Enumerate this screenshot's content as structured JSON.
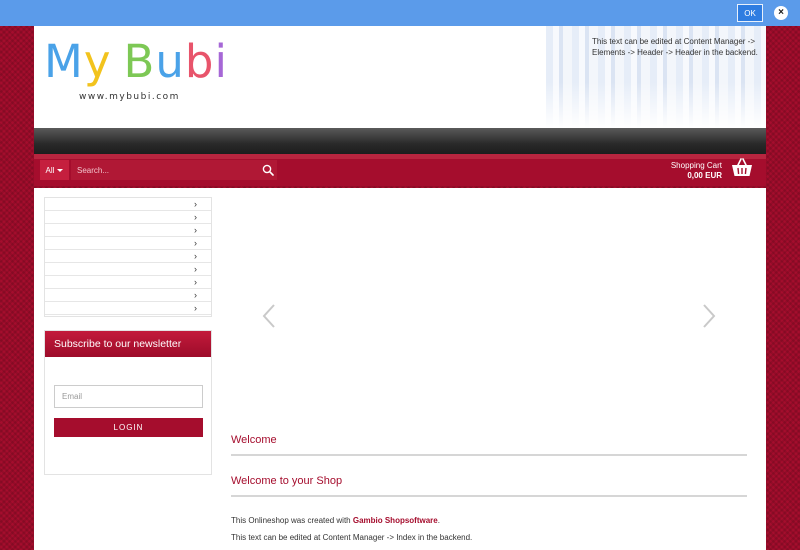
{
  "cookie_bar": {
    "ok_label": "OK",
    "close_label": "×"
  },
  "header": {
    "logo": [
      "M",
      "y",
      " ",
      "B",
      "u",
      "b",
      "i"
    ],
    "logo_colors": [
      "#4aa2e8",
      "#f2c31d",
      "#ffffff",
      "#7dc855",
      "#4aa2e8",
      "#e8546b",
      "#a667d6"
    ],
    "logo_url": "www.mybubi.com",
    "notice": "This text can be edited at Content Manager -> Elements -> Header -> Header in the backend."
  },
  "search": {
    "category_label": "All",
    "placeholder": "Search..."
  },
  "cart": {
    "label": "Shopping Cart",
    "amount": "0,00 EUR"
  },
  "categories": {
    "count": 9
  },
  "newsletter": {
    "title": "Subscribe to our newsletter",
    "email_placeholder": "Email",
    "login_label": "LOGIN"
  },
  "main": {
    "welcome_title": "Welcome",
    "shop_title": "Welcome to your Shop",
    "created_prefix": "This Onlineshop was created with ",
    "created_link": "Gambio Shopsoftware",
    "created_suffix": ".",
    "edit_note": "This text can be edited at Content Manager -> Index in the backend."
  },
  "colors": {
    "brand": "#a50d2d",
    "cookie_bar": "#5b9bea"
  }
}
